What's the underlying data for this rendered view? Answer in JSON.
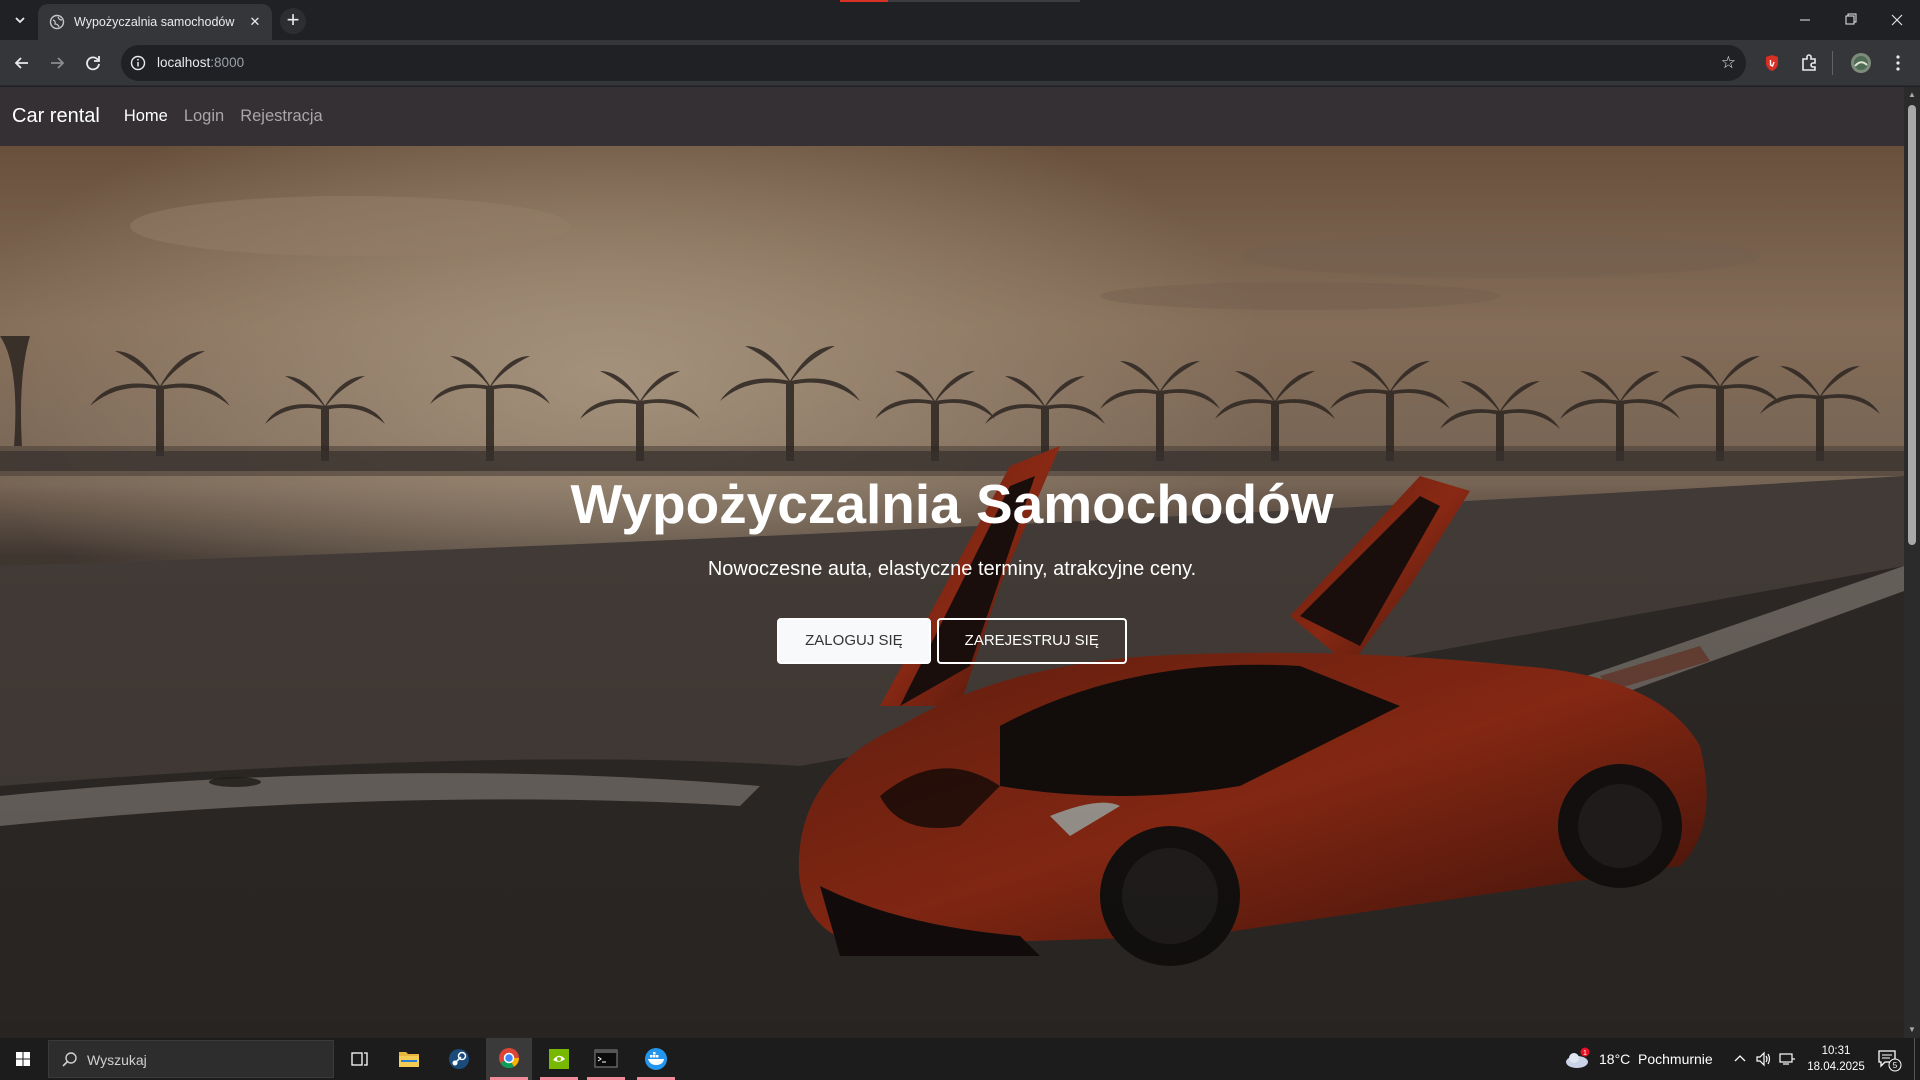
{
  "browser": {
    "tab_title": "Wypożyczalnia samochodów",
    "url_host": "localhost",
    "url_port": ":8000",
    "icons": [
      "tab-search-icon",
      "globe-icon",
      "close-icon",
      "plus-icon",
      "minimize-icon",
      "restore-icon",
      "window-close-icon",
      "back-icon",
      "forward-icon",
      "reload-icon",
      "site-info-icon",
      "star-icon",
      "extension-shield-icon",
      "extensions-icon",
      "profile-avatar-icon",
      "menu-dots-icon"
    ]
  },
  "navbar": {
    "brand": "Car rental",
    "links": [
      {
        "label": "Home",
        "active": true
      },
      {
        "label": "Login",
        "active": false
      },
      {
        "label": "Rejestracja",
        "active": false
      }
    ]
  },
  "hero": {
    "title": "Wypożyczalnia Samochodów",
    "subtitle": "Nowoczesne auta, elastyczne terminy, atrakcyjne ceny.",
    "login_button": "ZALOGUJ SIĘ",
    "register_button": "ZAREJESTRUJ SIĘ",
    "background": "orange sports car with open butterfly doors on a race track at sunset with palm trees"
  },
  "taskbar": {
    "search_placeholder": "Wyszukaj",
    "apps": [
      "task-view",
      "file-explorer",
      "steam",
      "chrome",
      "nvidia",
      "terminal",
      "docker"
    ],
    "weather": {
      "temp": "18°C",
      "condition": "Pochmurnie",
      "badge": "1"
    },
    "time": "10:31",
    "date": "18.04.2025",
    "notifications": "5"
  },
  "colors": {
    "navbar_bg": "#343034",
    "chrome_bg": "#202124",
    "toolbar_bg": "#35363a",
    "taskbar_bg": "#1c1c1c",
    "car_accent": "#c0391c"
  }
}
